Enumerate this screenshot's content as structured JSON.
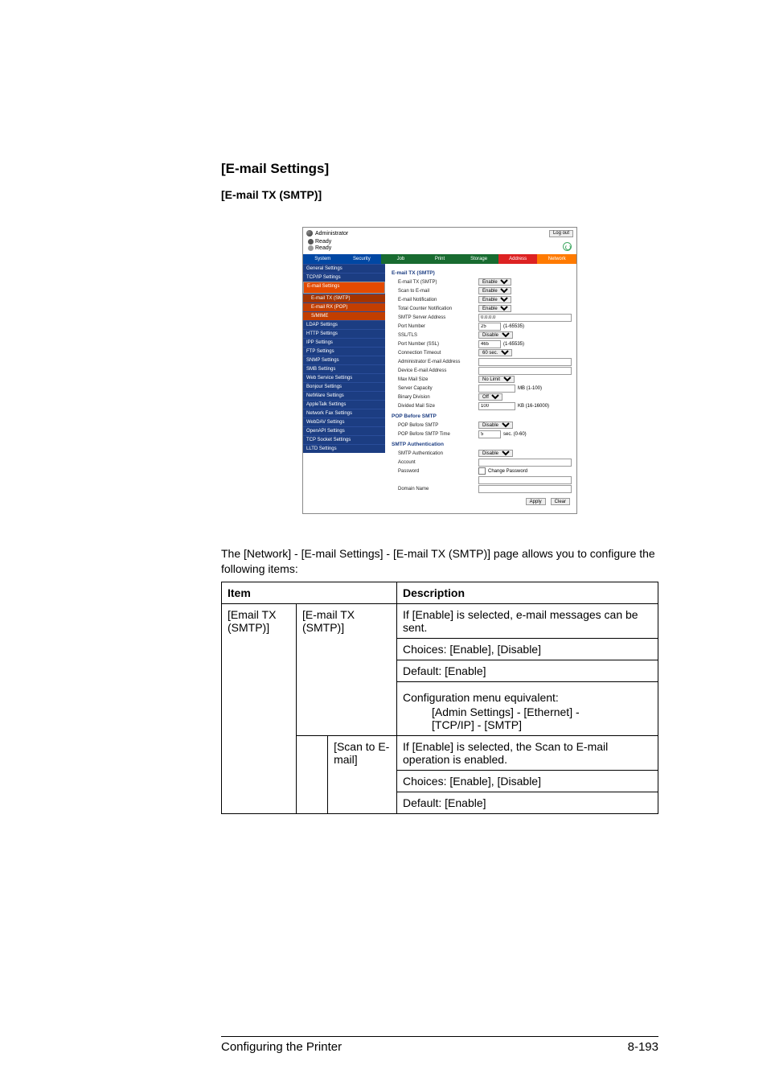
{
  "headings": {
    "h1": "[E-mail Settings]",
    "h2": "[E-mail TX (SMTP)]"
  },
  "shot": {
    "admin_label": "Administrator",
    "logout": "Log out",
    "ready": "Ready",
    "tabs": {
      "system": "System",
      "security": "Security",
      "job": "Job",
      "print": "Print",
      "storage": "Storage",
      "address": "Address",
      "network": "Network"
    },
    "sidebar": [
      "General Settings",
      "TCP/IP Settings",
      "E-mail Settings",
      "E-mail TX (SMTP)",
      "E-mail RX (POP)",
      "S/MIME",
      "LDAP Settings",
      "HTTP Settings",
      "IPP Settings",
      "FTP Settings",
      "SNMP Settings",
      "SMB Settings",
      "Web Service Settings",
      "Bonjour Settings",
      "NetWare Settings",
      "AppleTalk Settings",
      "Network Fax Settings",
      "WebDAV Settings",
      "OpenAPI Settings",
      "TCP Socket Settings",
      "LLTD Settings"
    ],
    "form": {
      "section_main": "E-mail TX (SMTP)",
      "rows": {
        "email_tx_smtp": {
          "label": "E-mail TX (SMTP)",
          "value": "Enable"
        },
        "scan_to_email": {
          "label": "Scan to E-mail",
          "value": "Enable"
        },
        "email_notif": {
          "label": "E-mail Notification",
          "value": "Enable"
        },
        "total_counter": {
          "label": "Total Counter Notification",
          "value": "Enable"
        },
        "smtp_addr": {
          "label": "SMTP Server Address",
          "value": "0.0.0.0"
        },
        "port": {
          "label": "Port Number",
          "value": "25",
          "suffix": "(1-65535)"
        },
        "ssltls": {
          "label": "SSL/TLS",
          "value": "Disable"
        },
        "port_ssl": {
          "label": "Port Number (SSL)",
          "value": "465",
          "suffix": "(1-65535)"
        },
        "conn_timeout": {
          "label": "Connection Timeout",
          "value": "60 sec."
        },
        "admin_email": {
          "label": "Administrator E-mail Address"
        },
        "device_email": {
          "label": "Device E-mail Address"
        },
        "max_mail": {
          "label": "Max Mail Size",
          "value": "No Limit"
        },
        "server_cap": {
          "label": "Server Capacity",
          "value": "",
          "suffix": "MB (1-100)"
        },
        "bin_div": {
          "label": "Binary Division",
          "value": "Off"
        },
        "div_size": {
          "label": "Divided Mail Size",
          "value": "100",
          "suffix": "KB (16-16000)"
        }
      },
      "section_pop": "POP Before SMTP",
      "pop": {
        "pop_before": {
          "label": "POP Before SMTP",
          "value": "Disable"
        },
        "pop_time": {
          "label": "POP Before SMTP Time",
          "value": "5",
          "suffix": "sec. (0-60)"
        }
      },
      "section_auth": "SMTP Authentication",
      "auth": {
        "smtp_auth": {
          "label": "SMTP Authentication",
          "value": "Disable"
        },
        "account": {
          "label": "Account"
        },
        "password": {
          "label": "Password",
          "cb_label": "Change Password"
        },
        "domain": {
          "label": "Domain Name"
        }
      },
      "buttons": {
        "apply": "Apply",
        "clear": "Clear"
      }
    }
  },
  "lead": "The [Network] - [E-mail Settings] - [E-mail TX (SMTP)] page allows you to configure the following items:",
  "table": {
    "th_item": "Item",
    "th_desc": "Description",
    "c11": "[Email TX (SMTP)]",
    "c12": "[E-mail TX (SMTP)]",
    "d1a": "If [Enable] is selected, e-mail messages can be sent.",
    "d1b": "Choices: [Enable], [Disable]",
    "d1c": "Default: [Enable]",
    "d1d_head": "Configuration menu equivalent:",
    "d1d_l1": "[Admin Settings] - [Ethernet] -",
    "d1d_l2": "[TCP/IP] - [SMTP]",
    "c22": "[Scan to E-mail]",
    "d2a": "If [Enable] is selected, the Scan to E-mail operation is enabled.",
    "d2b": "Choices: [Enable], [Disable]",
    "d2c": "Default: [Enable]"
  },
  "footer": {
    "left": "Configuring the Printer",
    "right": "8-193"
  }
}
